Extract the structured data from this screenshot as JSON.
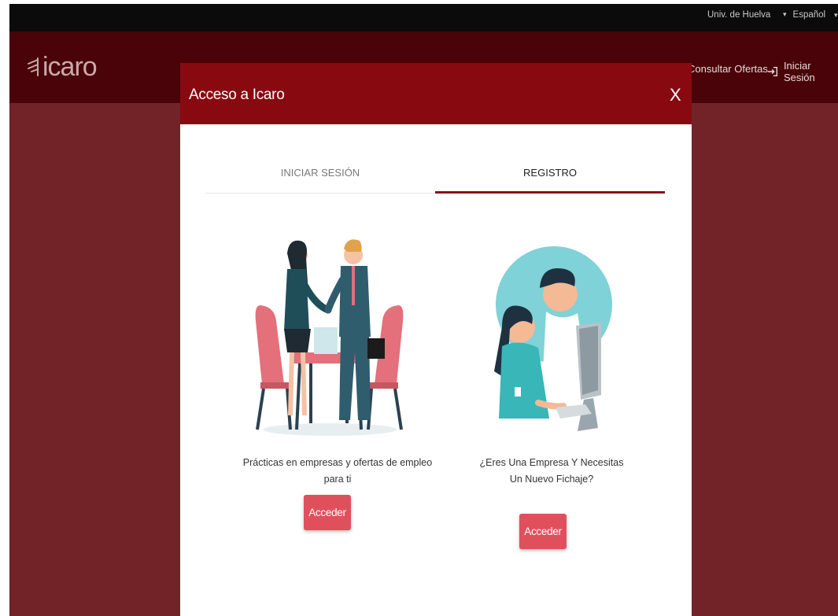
{
  "topbar": {
    "university": "Univ. de Huelva",
    "language": "Español",
    "caret": "▾"
  },
  "navbar": {
    "logo_text": "icaro",
    "consultar_ofertas": "Consultar Ofertas",
    "iniciar_sesion": "Iniciar Sesión"
  },
  "modal": {
    "title": "Acceso a Icaro",
    "close_label": "X",
    "tabs": [
      {
        "label": "INICIAR SESIÓN",
        "active": false
      },
      {
        "label": "REGISTRO",
        "active": true
      }
    ],
    "options": [
      {
        "caption": "Prácticas en empresas y ofertas de empleo para ti",
        "button": "Acceder",
        "icon": "handshake-meeting-illustration"
      },
      {
        "caption": "¿Eres Una Empresa Y Necesitas Un Nuevo Fichaje?",
        "button": "Acceder",
        "icon": "computer-workers-illustration"
      }
    ]
  },
  "colors": {
    "header_red": "#890910",
    "navbar": "#4a0308",
    "overlay": "#722327",
    "button": "#e0505c",
    "active_tab": "#8a0f17"
  }
}
